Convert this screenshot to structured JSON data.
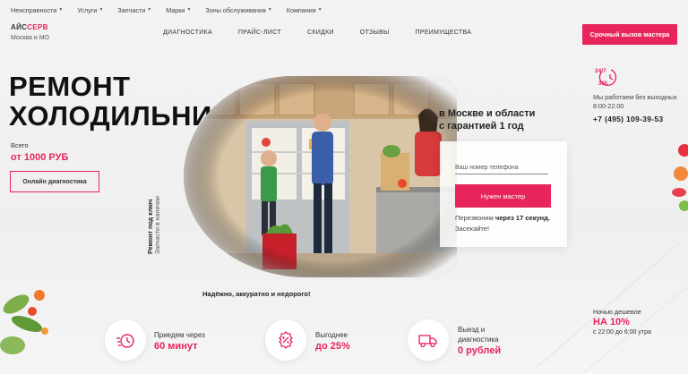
{
  "topnav": [
    {
      "label": "Неисправности"
    },
    {
      "label": "Услуги"
    },
    {
      "label": "Запчасти"
    },
    {
      "label": "Марки"
    },
    {
      "label": "Зоны обслуживания"
    },
    {
      "label": "Компания"
    }
  ],
  "logo": {
    "part1": "АЙС",
    "part2": "СЕРВ"
  },
  "city": "Москва и МО",
  "mainnav": [
    {
      "label": "ДИАГНОСТИКА"
    },
    {
      "label": "ПРАЙС-ЛИСТ"
    },
    {
      "label": "СКИДКИ"
    },
    {
      "label": "ОТЗЫВЫ"
    },
    {
      "label": "ПРЕИМУЩЕСТВА"
    }
  ],
  "urgent_button": "Срочный вызов мастера",
  "hero": {
    "title_line1": "РЕМОНТ",
    "title_line2": "ХОЛОДИЛЬНИКОВ",
    "from_label": "Всего",
    "price": "от 1000 РУБ",
    "online_button": "Онлайн диагностика",
    "vertical_1": "Ремонт под ключ",
    "vertical_2": "Запчасти в наличии",
    "subtitle_line1": "в Москве и области",
    "subtitle_line2": "с гарантией 1 год",
    "slogan": "Надёжно, аккуратно и недорого!"
  },
  "form": {
    "phone_placeholder": "Ваш номер телефона",
    "submit": "Нужен мастер",
    "callback_pre": "Перезвоним",
    "callback_bold": "через 17 секунд.",
    "callback_post": "Засекайте!"
  },
  "contacts": {
    "badge_top": "24/7",
    "badge_bottom": "365",
    "hours_line1": "Мы работаем без выходных",
    "hours_line2": "8:00-22:00",
    "phone": "+7 (495) 109-39-53"
  },
  "night": {
    "label": "Ночью дешевле",
    "discount": "НА 10%",
    "time": "с 22:00 до 6:00 утра"
  },
  "features": [
    {
      "icon": "clock-fast-icon",
      "label1": "Приедем через",
      "label2": "",
      "value": "60 минут"
    },
    {
      "icon": "percent-icon",
      "label1": "Выгоднее",
      "label2": "",
      "value": "до 25%"
    },
    {
      "icon": "truck-icon",
      "label1": "Выезд и",
      "label2": "диагностика",
      "value": "0 рублей"
    }
  ],
  "colors": {
    "accent": "#e8245c",
    "text": "#222222",
    "background": "#f2f2f2"
  }
}
